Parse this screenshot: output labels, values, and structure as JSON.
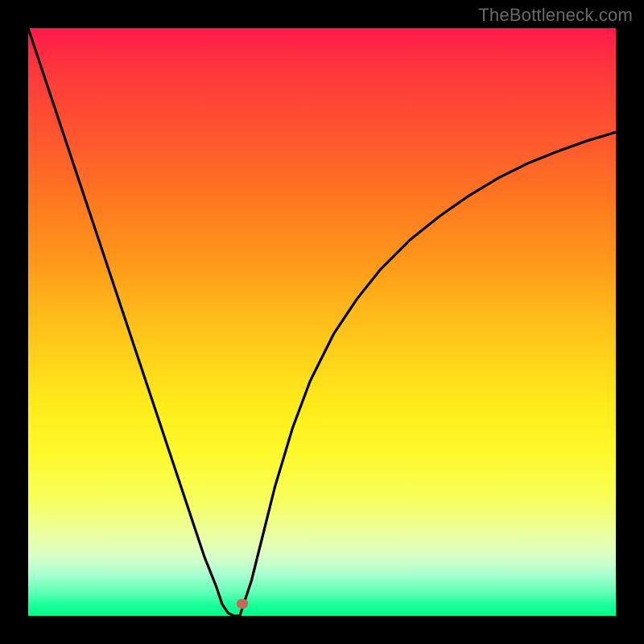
{
  "watermark": "TheBottleneck.com",
  "colors": {
    "frame": "#000000",
    "curve": "#000000",
    "dot": "#c46a5a"
  },
  "chart_data": {
    "type": "line",
    "title": "",
    "xlabel": "",
    "ylabel": "",
    "xlim": [
      0,
      100
    ],
    "ylim": [
      0,
      100
    ],
    "grid": false,
    "legend": false,
    "series": [
      {
        "name": "left-branch",
        "x": [
          0,
          2,
          4,
          6,
          8,
          10,
          12,
          14,
          16,
          18,
          20,
          22,
          24,
          26,
          28,
          30,
          32,
          33,
          34,
          35
        ],
        "values": [
          100,
          94,
          88,
          82,
          76,
          70,
          64,
          58,
          52,
          46,
          40,
          34,
          28,
          22,
          16,
          10,
          5,
          2,
          0.5,
          0
        ]
      },
      {
        "name": "right-branch",
        "x": [
          36,
          38,
          40,
          42,
          45,
          48,
          52,
          56,
          60,
          65,
          70,
          75,
          80,
          85,
          90,
          95,
          100
        ],
        "values": [
          0,
          6,
          14,
          22,
          32,
          40,
          48,
          54,
          59,
          64,
          68,
          71.5,
          74.5,
          77,
          79,
          80.8,
          82.3
        ]
      }
    ],
    "annotations": [
      {
        "name": "tip-dot",
        "x": 36.5,
        "y": 2,
        "color": "#c46a5a"
      }
    ],
    "background_gradient": {
      "orientation": "vertical",
      "stops": [
        {
          "pos": 0.0,
          "color": "#ff1a4a"
        },
        {
          "pos": 0.5,
          "color": "#ffd21a"
        },
        {
          "pos": 0.9,
          "color": "#d8ffc8"
        },
        {
          "pos": 1.0,
          "color": "#00ff88"
        }
      ]
    }
  }
}
